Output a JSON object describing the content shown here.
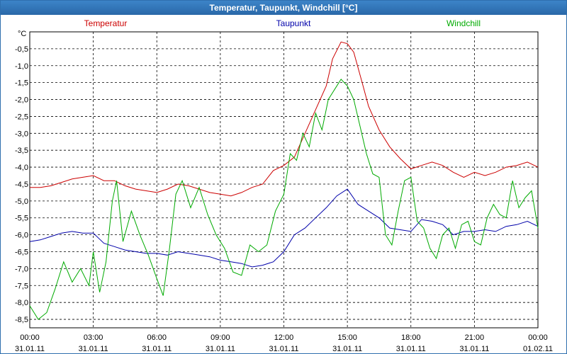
{
  "window": {
    "title": "Temperatur, Taupunkt, Windchill [°C]"
  },
  "chart_data": {
    "type": "line",
    "title": "Temperatur, Taupunkt, Windchill [°C]",
    "ylabel": "°C",
    "xlabel": "",
    "ylim": [
      -8.75,
      0.0
    ],
    "xlim": [
      0,
      24
    ],
    "grid": true,
    "legend_placement": "top",
    "y_ticks": [
      -0.5,
      -1.0,
      -1.5,
      -2.0,
      -2.5,
      -3.0,
      -3.5,
      -4.0,
      -4.5,
      -5.0,
      -5.5,
      -6.0,
      -6.5,
      -7.0,
      -7.5,
      -8.0,
      -8.5
    ],
    "y_tick_labels": [
      "-0,5",
      "-1,0",
      "-1,5",
      "-2,0",
      "-2,5",
      "-3,0",
      "-3,5",
      "-4,0",
      "-4,5",
      "-5,0",
      "-5,5",
      "-6,0",
      "-6,5",
      "-7,0",
      "-7,5",
      "-8,0",
      "-8,5"
    ],
    "x_ticks": [
      {
        "x": 0,
        "time": "00:00",
        "date": "31.01.11"
      },
      {
        "x": 3,
        "time": "03:00",
        "date": "31.01.11"
      },
      {
        "x": 6,
        "time": "06:00",
        "date": "31.01.11"
      },
      {
        "x": 9,
        "time": "09:00",
        "date": "31.01.11"
      },
      {
        "x": 12,
        "time": "12:00",
        "date": "31.01.11"
      },
      {
        "x": 15,
        "time": "15:00",
        "date": "31.01.11"
      },
      {
        "x": 18,
        "time": "18:00",
        "date": "31.01.11"
      },
      {
        "x": 21,
        "time": "21:00",
        "date": "31.01.11"
      },
      {
        "x": 24,
        "time": "00:00",
        "date": "01.02.11"
      }
    ],
    "series": [
      {
        "name": "Temperatur",
        "color": "#cc0000",
        "points": [
          [
            0,
            -4.6
          ],
          [
            0.5,
            -4.6
          ],
          [
            1,
            -4.55
          ],
          [
            1.5,
            -4.45
          ],
          [
            2,
            -4.35
          ],
          [
            2.5,
            -4.3
          ],
          [
            3,
            -4.25
          ],
          [
            3.5,
            -4.4
          ],
          [
            4,
            -4.4
          ],
          [
            4.5,
            -4.55
          ],
          [
            5,
            -4.65
          ],
          [
            5.5,
            -4.7
          ],
          [
            6,
            -4.75
          ],
          [
            6.5,
            -4.65
          ],
          [
            7,
            -4.5
          ],
          [
            7.5,
            -4.55
          ],
          [
            8,
            -4.65
          ],
          [
            8.5,
            -4.75
          ],
          [
            9,
            -4.8
          ],
          [
            9.5,
            -4.85
          ],
          [
            10,
            -4.75
          ],
          [
            10.5,
            -4.6
          ],
          [
            11,
            -4.5
          ],
          [
            11.5,
            -4.1
          ],
          [
            12,
            -3.95
          ],
          [
            12.5,
            -3.7
          ],
          [
            13,
            -3.0
          ],
          [
            13.5,
            -2.3
          ],
          [
            14,
            -1.6
          ],
          [
            14.3,
            -0.8
          ],
          [
            14.7,
            -0.3
          ],
          [
            15,
            -0.35
          ],
          [
            15.3,
            -0.6
          ],
          [
            15.7,
            -1.5
          ],
          [
            16,
            -2.2
          ],
          [
            16.5,
            -2.9
          ],
          [
            17,
            -3.4
          ],
          [
            17.5,
            -3.75
          ],
          [
            18,
            -4.05
          ],
          [
            18.5,
            -3.95
          ],
          [
            19,
            -3.85
          ],
          [
            19.5,
            -3.95
          ],
          [
            20,
            -4.15
          ],
          [
            20.5,
            -4.3
          ],
          [
            21,
            -4.15
          ],
          [
            21.5,
            -4.25
          ],
          [
            22,
            -4.15
          ],
          [
            22.5,
            -4.0
          ],
          [
            23,
            -3.95
          ],
          [
            23.5,
            -3.85
          ],
          [
            24,
            -4.0
          ]
        ]
      },
      {
        "name": "Taupunkt",
        "color": "#0000aa",
        "points": [
          [
            0,
            -6.2
          ],
          [
            0.5,
            -6.15
          ],
          [
            1,
            -6.05
          ],
          [
            1.5,
            -5.95
          ],
          [
            2,
            -5.9
          ],
          [
            2.5,
            -5.95
          ],
          [
            3,
            -5.95
          ],
          [
            3.5,
            -6.25
          ],
          [
            4,
            -6.35
          ],
          [
            4.5,
            -6.45
          ],
          [
            5,
            -6.5
          ],
          [
            5.5,
            -6.55
          ],
          [
            6,
            -6.55
          ],
          [
            6.5,
            -6.6
          ],
          [
            7,
            -6.5
          ],
          [
            7.5,
            -6.55
          ],
          [
            8,
            -6.6
          ],
          [
            8.5,
            -6.65
          ],
          [
            9,
            -6.75
          ],
          [
            9.5,
            -6.8
          ],
          [
            10,
            -6.85
          ],
          [
            10.5,
            -6.95
          ],
          [
            11,
            -6.9
          ],
          [
            11.5,
            -6.8
          ],
          [
            12,
            -6.5
          ],
          [
            12.5,
            -6.0
          ],
          [
            13,
            -5.8
          ],
          [
            13.5,
            -5.5
          ],
          [
            14,
            -5.2
          ],
          [
            14.5,
            -4.85
          ],
          [
            15,
            -4.65
          ],
          [
            15.5,
            -5.1
          ],
          [
            16,
            -5.3
          ],
          [
            16.5,
            -5.5
          ],
          [
            17,
            -5.8
          ],
          [
            17.5,
            -5.85
          ],
          [
            18,
            -5.9
          ],
          [
            18.5,
            -5.55
          ],
          [
            19,
            -5.6
          ],
          [
            19.5,
            -5.7
          ],
          [
            20,
            -6.0
          ],
          [
            20.5,
            -5.9
          ],
          [
            21,
            -5.9
          ],
          [
            21.5,
            -5.85
          ],
          [
            22,
            -5.9
          ],
          [
            22.5,
            -5.75
          ],
          [
            23,
            -5.7
          ],
          [
            23.5,
            -5.6
          ],
          [
            24,
            -5.75
          ]
        ]
      },
      {
        "name": "Windchill",
        "color": "#00aa00",
        "points": [
          [
            0,
            -8.1
          ],
          [
            0.4,
            -8.5
          ],
          [
            0.8,
            -8.3
          ],
          [
            1.2,
            -7.6
          ],
          [
            1.6,
            -6.8
          ],
          [
            2,
            -7.4
          ],
          [
            2.4,
            -7.0
          ],
          [
            2.8,
            -7.5
          ],
          [
            3,
            -6.5
          ],
          [
            3.3,
            -7.7
          ],
          [
            3.6,
            -6.8
          ],
          [
            3.9,
            -5.0
          ],
          [
            4.1,
            -4.4
          ],
          [
            4.4,
            -6.2
          ],
          [
            4.8,
            -5.3
          ],
          [
            5.2,
            -6.0
          ],
          [
            5.6,
            -6.6
          ],
          [
            6,
            -7.3
          ],
          [
            6.3,
            -7.8
          ],
          [
            6.6,
            -6.4
          ],
          [
            6.9,
            -4.8
          ],
          [
            7.2,
            -4.4
          ],
          [
            7.6,
            -5.2
          ],
          [
            8,
            -4.6
          ],
          [
            8.4,
            -5.4
          ],
          [
            8.8,
            -6.0
          ],
          [
            9.2,
            -6.4
          ],
          [
            9.6,
            -7.1
          ],
          [
            10,
            -7.2
          ],
          [
            10.4,
            -6.3
          ],
          [
            10.8,
            -6.5
          ],
          [
            11.2,
            -6.3
          ],
          [
            11.6,
            -5.3
          ],
          [
            12,
            -4.8
          ],
          [
            12.3,
            -3.6
          ],
          [
            12.6,
            -3.8
          ],
          [
            12.9,
            -3.0
          ],
          [
            13.2,
            -3.4
          ],
          [
            13.5,
            -2.4
          ],
          [
            13.8,
            -2.9
          ],
          [
            14.1,
            -2.0
          ],
          [
            14.4,
            -1.7
          ],
          [
            14.7,
            -1.4
          ],
          [
            15,
            -1.6
          ],
          [
            15.3,
            -2.0
          ],
          [
            15.6,
            -2.8
          ],
          [
            15.9,
            -3.6
          ],
          [
            16.2,
            -4.2
          ],
          [
            16.5,
            -4.3
          ],
          [
            16.8,
            -6.0
          ],
          [
            17.1,
            -6.3
          ],
          [
            17.4,
            -5.3
          ],
          [
            17.7,
            -4.4
          ],
          [
            18,
            -4.3
          ],
          [
            18.3,
            -5.6
          ],
          [
            18.6,
            -5.8
          ],
          [
            18.9,
            -6.4
          ],
          [
            19.2,
            -6.7
          ],
          [
            19.5,
            -6.0
          ],
          [
            19.8,
            -5.8
          ],
          [
            20.1,
            -6.4
          ],
          [
            20.4,
            -5.7
          ],
          [
            20.7,
            -5.6
          ],
          [
            21,
            -6.2
          ],
          [
            21.3,
            -6.3
          ],
          [
            21.6,
            -5.5
          ],
          [
            21.9,
            -5.1
          ],
          [
            22.2,
            -5.4
          ],
          [
            22.5,
            -5.5
          ],
          [
            22.8,
            -4.4
          ],
          [
            23.1,
            -5.2
          ],
          [
            23.4,
            -4.9
          ],
          [
            23.7,
            -4.7
          ],
          [
            24,
            -5.8
          ]
        ]
      }
    ]
  }
}
